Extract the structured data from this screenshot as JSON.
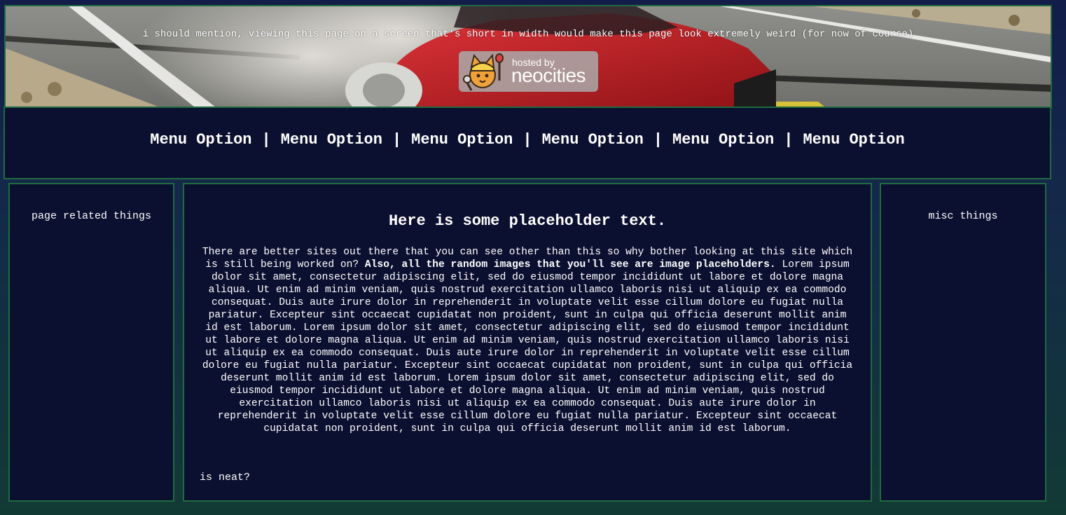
{
  "header": {
    "notice": "i should mention, viewing this page on a screen that's short in width would make this page look extremely weird (for now of course)",
    "badge": {
      "small_text": "hosted by",
      "big_text": "neocities"
    }
  },
  "nav": {
    "items": [
      {
        "label": "Menu Option"
      },
      {
        "label": "Menu Option"
      },
      {
        "label": "Menu Option"
      },
      {
        "label": "Menu Option"
      },
      {
        "label": "Menu Option"
      },
      {
        "label": "Menu Option"
      }
    ],
    "separator": "|"
  },
  "left_sidebar": {
    "title": "page related things"
  },
  "main": {
    "heading": "Here is some placeholder text.",
    "intro": "There are better sites out there that you can see other than this so why bother looking at this site which is still being worked on? ",
    "bold_note": "Also, all the random images that you'll see are image placeholders.",
    "lorem": " Lorem ipsum dolor sit amet, consectetur adipiscing elit, sed do eiusmod tempor incididunt ut labore et dolore magna aliqua. Ut enim ad minim veniam, quis nostrud exercitation ullamco laboris nisi ut aliquip ex ea commodo consequat. Duis aute irure dolor in reprehenderit in voluptate velit esse cillum dolore eu fugiat nulla pariatur. Excepteur sint occaecat cupidatat non proident, sunt in culpa qui officia deserunt mollit anim id est laborum. Lorem ipsum dolor sit amet, consectetur adipiscing elit, sed do eiusmod tempor incididunt ut labore et dolore magna aliqua. Ut enim ad minim veniam, quis nostrud exercitation ullamco laboris nisi ut aliquip ex ea commodo consequat. Duis aute irure dolor in reprehenderit in voluptate velit esse cillum dolore eu fugiat nulla pariatur. Excepteur sint occaecat cupidatat non proident, sunt in culpa qui officia deserunt mollit anim id est laborum. Lorem ipsum dolor sit amet, consectetur adipiscing elit, sed do eiusmod tempor incididunt ut labore et dolore magna aliqua. Ut enim ad minim veniam, quis nostrud exercitation ullamco laboris nisi ut aliquip ex ea commodo consequat. Duis aute irure dolor in reprehenderit in voluptate velit esse cillum dolore eu fugiat nulla pariatur. Excepteur sint occaecat cupidatat non proident, sunt in culpa qui officia deserunt mollit anim id est laborum.",
    "footer": "is neat?"
  },
  "right_sidebar": {
    "title": "misc things"
  },
  "colors": {
    "panel_bg": "#0c1030",
    "border": "#1f6b3f",
    "text": "#ffffff",
    "car_red": "#c41f24"
  },
  "icons": {
    "badge_mascot": "neocities-cat-mascot-icon"
  }
}
